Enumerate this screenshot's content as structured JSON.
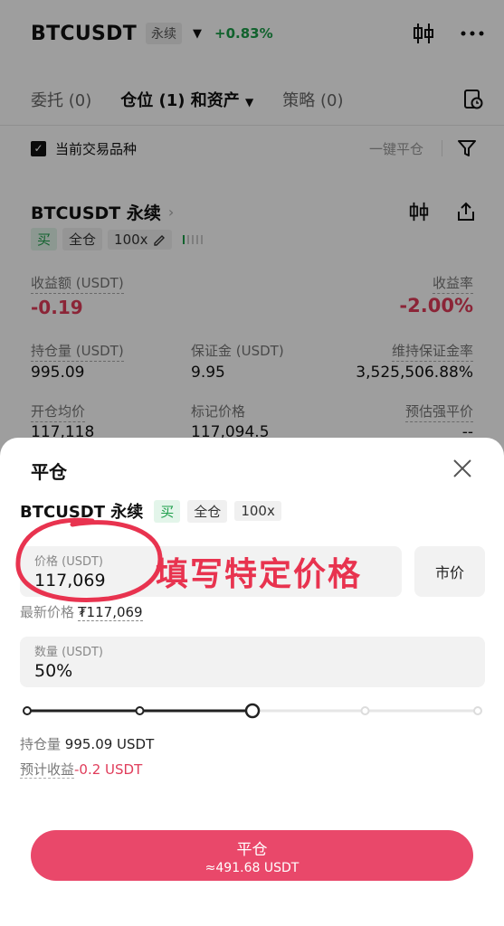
{
  "header": {
    "pair": "BTCUSDT",
    "type_tag": "永续",
    "change": "+0.83%",
    "icons": [
      "candlestick-icon",
      "more-icon"
    ]
  },
  "tabs": [
    {
      "label": "委托 (0)"
    },
    {
      "label": "仓位 (1) 和资产"
    },
    {
      "label": "策略 (0)"
    }
  ],
  "filter": {
    "current_only_label": "当前交易品种",
    "close_all_label": "一键平仓"
  },
  "position": {
    "title": "BTCUSDT 永续",
    "side": "买",
    "margin_mode": "全仓",
    "leverage": "100x",
    "pnl_label": "收益额 (USDT)",
    "pnl_value": "-0.19",
    "roe_label": "收益率",
    "roe_value": "-2.00%",
    "size_label": "持仓量 (USDT)",
    "size_value": "995.09",
    "margin_label": "保证金 (USDT)",
    "margin_value": "9.95",
    "mmr_label": "维持保证金率",
    "mmr_value": "3,525,506.88%",
    "entry_label": "开仓均价",
    "entry_value": "117,118",
    "mark_label": "标记价格",
    "mark_value": "117,094.5",
    "liq_label": "预估强平价",
    "liq_value": "--"
  },
  "sheet": {
    "title": "平仓",
    "pair": "BTCUSDT 永续",
    "side": "买",
    "margin_mode": "全仓",
    "leverage": "100x",
    "price_label": "价格 (USDT)",
    "price_value": "117,069",
    "market_label": "市价",
    "annotation": "填写特定价格",
    "latest_label": "最新价格",
    "latest_value": "₮117,069",
    "qty_label": "数量 (USDT)",
    "qty_value": "50%",
    "slider_fraction": 0.5,
    "hold_label": "持仓量",
    "hold_value": "995.09 USDT",
    "est_label": "预计收益",
    "est_value": "-0.2 USDT",
    "close_button_label": "平仓",
    "close_button_sub": "≈491.68 USDT"
  },
  "colors": {
    "green": "#1c9e4a",
    "red": "#e03c5a",
    "button": "#e9486a"
  }
}
